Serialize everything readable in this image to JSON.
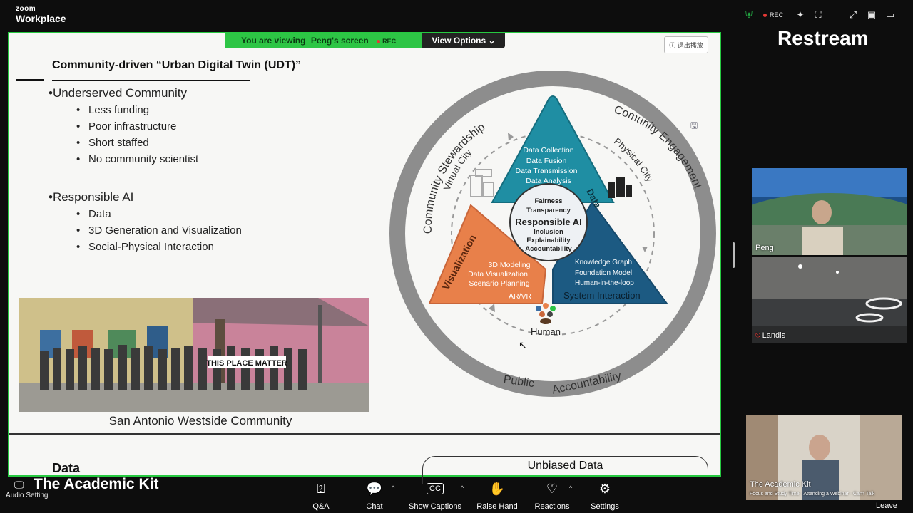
{
  "app": {
    "brand_small": "zoom",
    "brand_name": "Workplace"
  },
  "top": {
    "rec_label": "REC",
    "restream_label": "Restream"
  },
  "viewbar": {
    "prefix": "You are viewing",
    "name": "Peng's screen",
    "rec": "REC",
    "view_options": "View Options"
  },
  "slide": {
    "exit_label": "退出播放",
    "title": "Community-driven “Urban Digital Twin (UDT)”",
    "section1_heading": "•Underserved Community",
    "section1_items": [
      "Less funding",
      "Poor infrastructure",
      "Short staffed",
      "No community scientist"
    ],
    "section2_heading": "•Responsible AI",
    "section2_items": [
      "Data",
      "3D Generation and Visualization",
      "Social-Physical Interaction"
    ],
    "photo_caption": "San Antonio Westside Community",
    "photo_sign": "THIS PLACE MATTER",
    "bottom_heading": "Data",
    "bottom_box": "Unbiased Data",
    "diagram": {
      "ring_left": "Community Stewardship",
      "ring_right": "Comunity Engagement",
      "ring_bottom_left": "Public",
      "ring_bottom_right": "Accountability",
      "virtual_city": "Virtual City",
      "physical_city": "Physical City",
      "human": "Human",
      "top_label": "Data",
      "top_lines": [
        "Data Collection",
        "Data Fusion",
        "Data Transmission",
        "Data Analysis"
      ],
      "left_label": "Visualization",
      "left_lines": [
        "3D Modeling",
        "Data Visualization",
        "Scenario Planning",
        "AR/VR"
      ],
      "right_label": "System Interaction",
      "right_lines": [
        "Knowledge Graph",
        "Foundation Model",
        "Human-in-the-loop"
      ],
      "center_title": "Responsible AI",
      "center_top": [
        "Fairness",
        "Transparency"
      ],
      "center_bottom": [
        "Inclusion",
        "Explainability",
        "Accountability"
      ]
    }
  },
  "participants": [
    {
      "name": "Peng"
    },
    {
      "name": "Landis"
    },
    {
      "name": "The Academic Kit",
      "subtitle": "Focus and Study Time · Attending a Webinar · Can't Talk"
    }
  ],
  "toolbar": {
    "meeting_name": "The Academic Kit",
    "audio_setting": "Audio Setting",
    "buttons": [
      {
        "label": "Q&A",
        "icon": "qa-icon"
      },
      {
        "label": "Chat",
        "icon": "chat-icon"
      },
      {
        "label": "Show Captions",
        "icon": "captions-icon"
      },
      {
        "label": "Raise Hand",
        "icon": "hand-icon"
      },
      {
        "label": "Reactions",
        "icon": "heart-icon"
      },
      {
        "label": "Settings",
        "icon": "gear-icon"
      }
    ],
    "leave": "Leave"
  },
  "colors": {
    "zoom_green": "#2dc545",
    "teal": "#1f8ea3",
    "orange": "#e8804a",
    "navy": "#1c5a82",
    "ring": "#8d8d8d"
  }
}
